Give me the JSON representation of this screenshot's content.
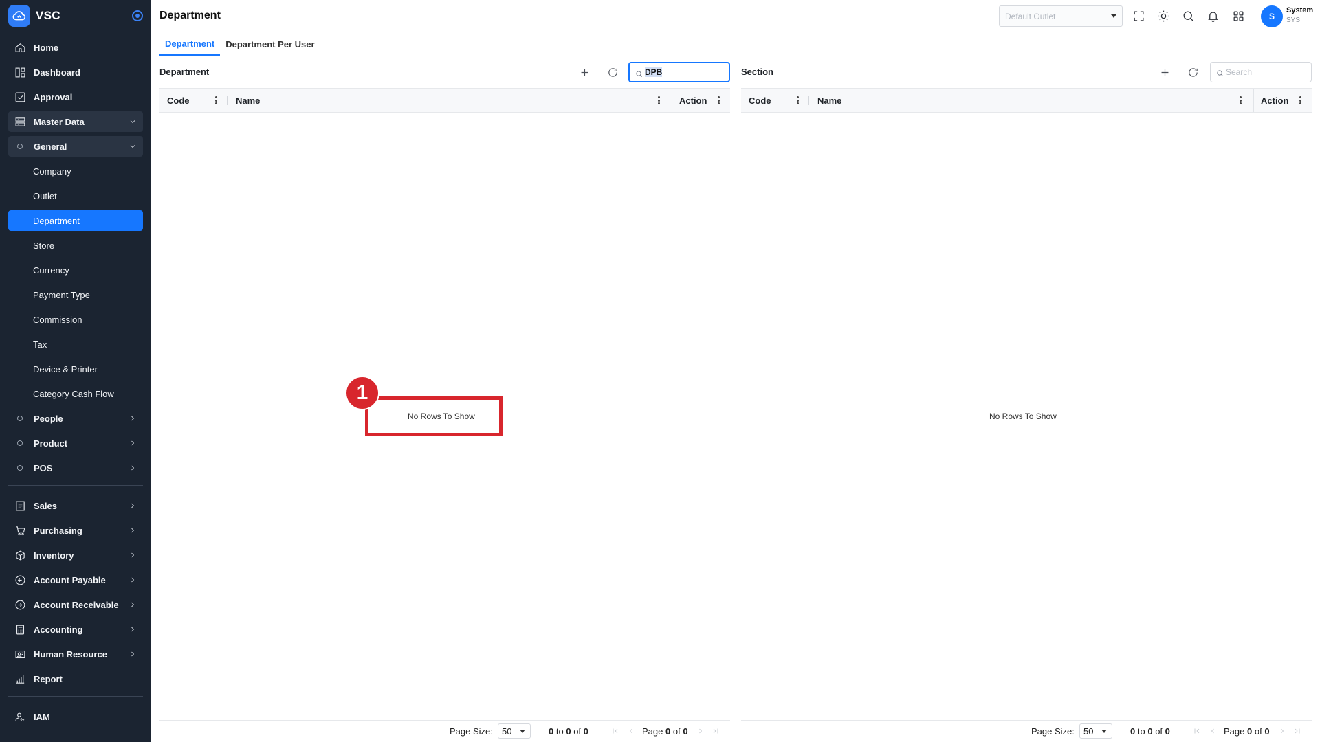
{
  "app": {
    "brand": "VSC",
    "page_title": "Department"
  },
  "sidebar": {
    "items": [
      {
        "label": "Home",
        "icon": "home-icon"
      },
      {
        "label": "Dashboard",
        "icon": "dashboard-icon"
      },
      {
        "label": "Approval",
        "icon": "approval-icon"
      },
      {
        "label": "Master Data",
        "icon": "master-data-icon",
        "expanded": true
      },
      {
        "label": "General",
        "expanded": true
      },
      {
        "label": "Company"
      },
      {
        "label": "Outlet"
      },
      {
        "label": "Department",
        "active": true
      },
      {
        "label": "Store"
      },
      {
        "label": "Currency"
      },
      {
        "label": "Payment Type"
      },
      {
        "label": "Commission"
      },
      {
        "label": "Tax"
      },
      {
        "label": "Device & Printer"
      },
      {
        "label": "Category Cash Flow"
      },
      {
        "label": "People"
      },
      {
        "label": "Product"
      },
      {
        "label": "POS"
      },
      {
        "label": "Sales",
        "icon": "sales-icon"
      },
      {
        "label": "Purchasing",
        "icon": "cart-icon"
      },
      {
        "label": "Inventory",
        "icon": "box-icon"
      },
      {
        "label": "Account Payable",
        "icon": "payable-icon"
      },
      {
        "label": "Account Receivable",
        "icon": "receivable-icon"
      },
      {
        "label": "Accounting",
        "icon": "calculator-icon"
      },
      {
        "label": "Human Resource",
        "icon": "id-card-icon"
      },
      {
        "label": "Report",
        "icon": "bar-chart-icon"
      },
      {
        "label": "IAM",
        "icon": "user-key-icon"
      }
    ]
  },
  "header": {
    "outlet_placeholder": "Default Outlet",
    "user_initial": "S",
    "user_name": "System",
    "user_code": "SYS"
  },
  "tabs": [
    {
      "label": "Department",
      "active": true
    },
    {
      "label": "Department Per User",
      "active": false
    }
  ],
  "left_panel": {
    "title": "Department",
    "search_value": "DPB",
    "columns": [
      "Code",
      "Name",
      "Action"
    ],
    "empty_text": "No Rows To Show",
    "footer": {
      "page_size_label": "Page Size:",
      "page_size": "50",
      "range_from": "0",
      "range_to_label": "to",
      "range_to": "0",
      "of_label": "of",
      "total": "0",
      "page_label": "Page",
      "page": "0",
      "page_of_label": "of",
      "page_total": "0"
    }
  },
  "right_panel": {
    "title": "Section",
    "search_placeholder": "Search",
    "columns": [
      "Code",
      "Name",
      "Action"
    ],
    "empty_text": "No Rows To Show",
    "footer": {
      "page_size_label": "Page Size:",
      "page_size": "50",
      "range_from": "0",
      "range_to_label": "to",
      "range_to": "0",
      "of_label": "of",
      "total": "0",
      "page_label": "Page",
      "page": "0",
      "page_of_label": "of",
      "page_total": "0"
    }
  },
  "annotation": {
    "badge": "1",
    "color": "#d8262d"
  },
  "colors": {
    "sidebar_bg": "#1b2431",
    "accent": "#1677ff"
  }
}
